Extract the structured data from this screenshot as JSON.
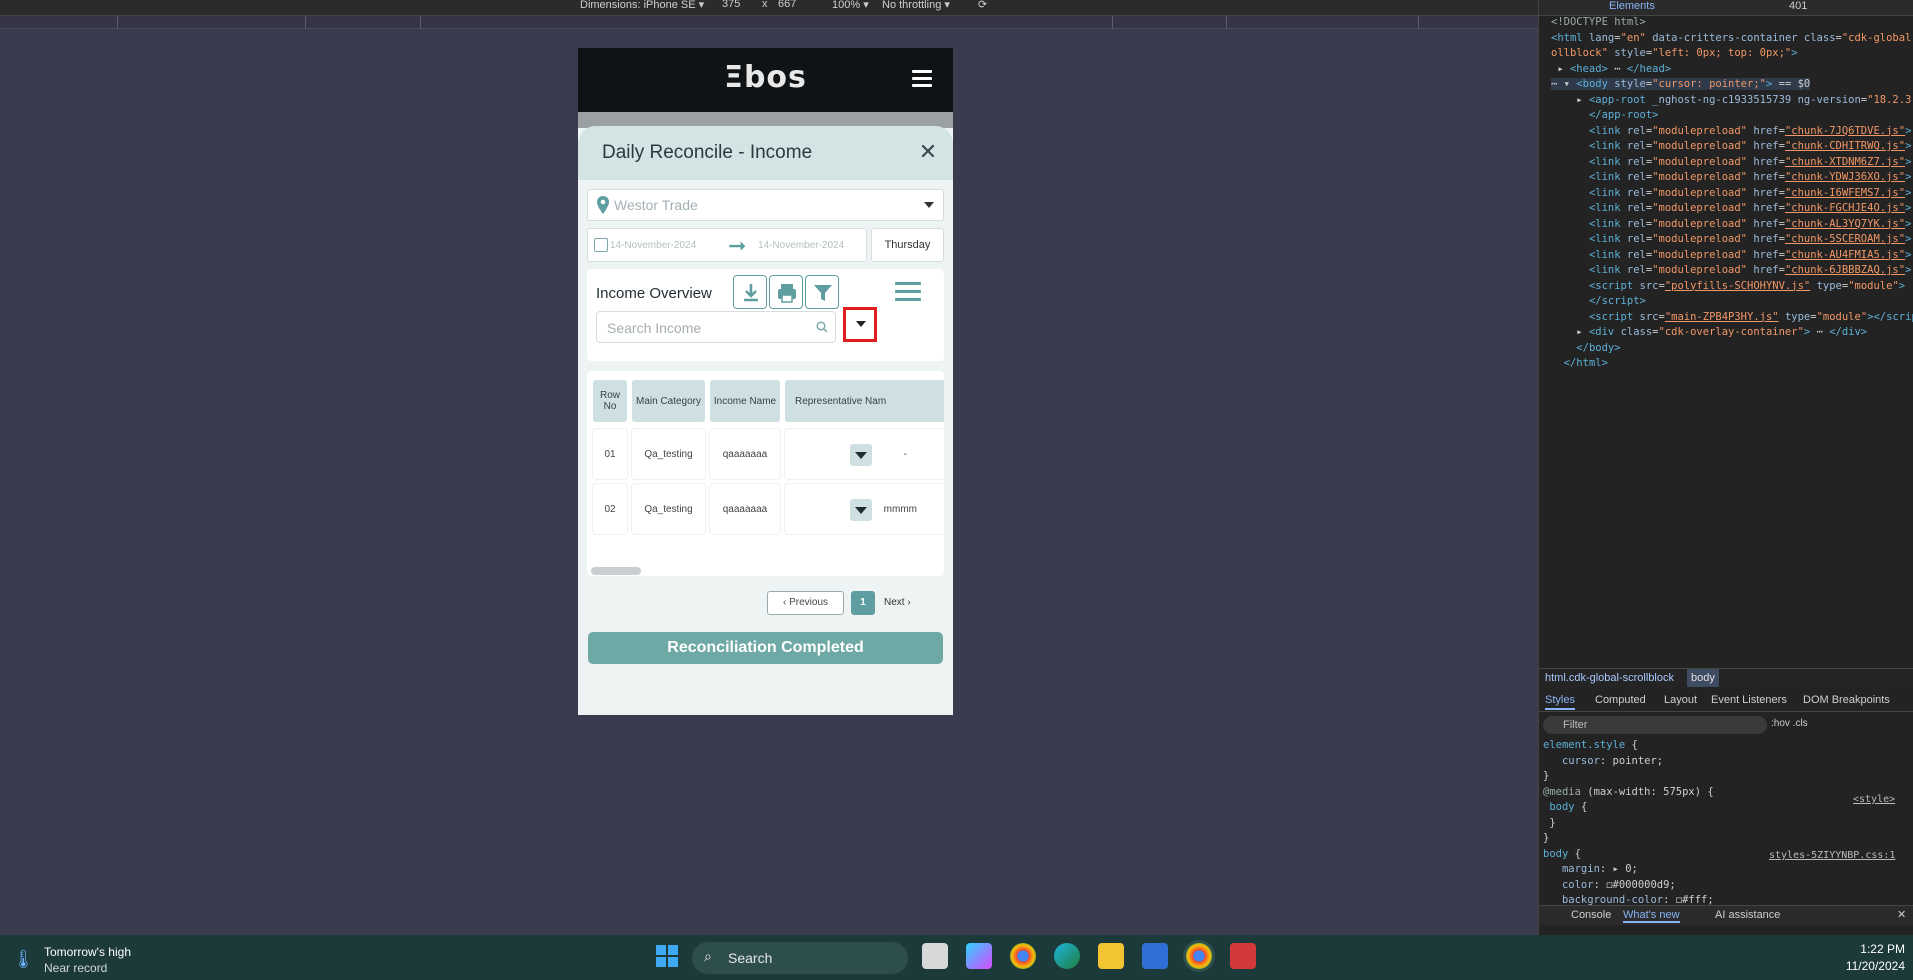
{
  "devtools_bar": {
    "dimensions_label": "Dimensions: iPhone SE ▾",
    "width": "375",
    "x": "x",
    "height": "667",
    "zoom": "100% ▾",
    "throttle": "No throttling ▾"
  },
  "app": {
    "logo": "Ξbos",
    "modal_title": "Daily Reconcile - Income",
    "close_symbol": "✕",
    "location_placeholder": "Westor Trade",
    "date_from": "14-November-2024",
    "date_to": "14-November-2024",
    "day": "Thursday",
    "overview_title": "Income Overview",
    "search_placeholder": "Search Income",
    "table": {
      "headers": [
        "Row No",
        "Main Category",
        "Income Name",
        "Representative Nam"
      ],
      "rows": [
        {
          "no": "01",
          "category": "Qa_testing",
          "income": "qaaaaaaa",
          "rep": "-"
        },
        {
          "no": "02",
          "category": "Qa_testing",
          "income": "qaaaaaaa",
          "rep": "mmmm"
        }
      ]
    },
    "pagination": {
      "previous": "Previous",
      "page": "1",
      "next": "Next"
    },
    "reconcile_button": "Reconciliation Completed"
  },
  "devtools": {
    "tabs_top": "Elements",
    "errors": "401",
    "breadcrumb": [
      "html.cdk-global-scrollblock",
      "body"
    ],
    "styles_tabs": [
      "Styles",
      "Computed",
      "Layout",
      "Event Listeners",
      "DOM Breakpoints"
    ],
    "filter_placeholder": "Filter",
    "filter_buttons": ":hov .cls",
    "console_tabs": [
      "Console",
      "What's new",
      "AI assistance"
    ],
    "styles_source_1": "<style>",
    "styles_source_2": "styles-5ZIYYNBP.css:1"
  },
  "taskbar": {
    "weather_title": "Tomorrow's high",
    "weather_sub": "Near record",
    "search_label": "Search",
    "time": "1:22 PM",
    "date": "11/20/2024"
  },
  "colors": {
    "teal": "#5f9ea0",
    "header_bg": "#d4e4e5",
    "highlight_red": "#e11d1d"
  }
}
